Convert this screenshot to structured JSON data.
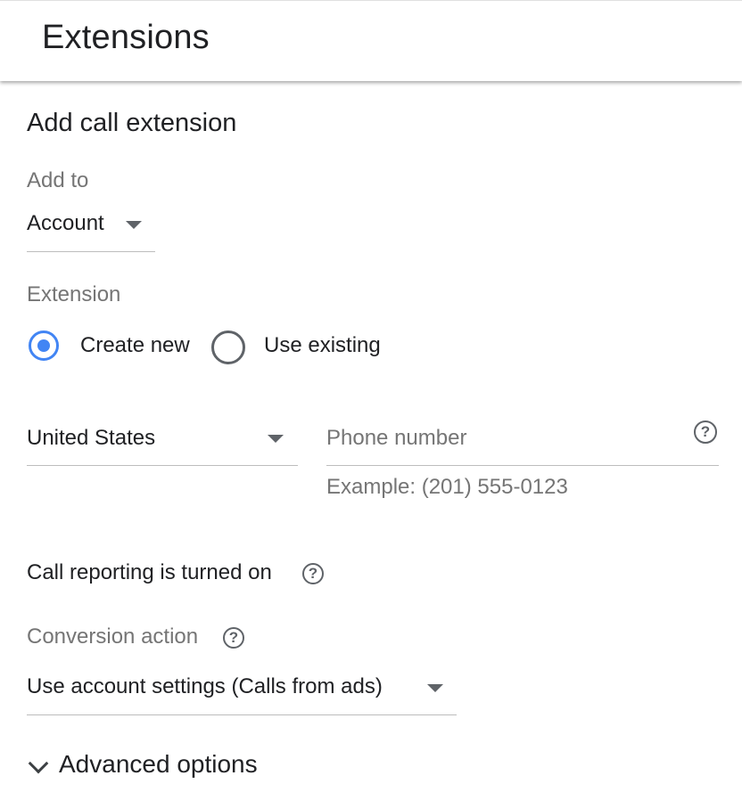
{
  "header": {
    "title": "Extensions"
  },
  "form": {
    "section_title": "Add call extension",
    "add_to": {
      "label": "Add to",
      "value": "Account"
    },
    "extension": {
      "label": "Extension",
      "options": [
        {
          "label": "Create new",
          "selected": true
        },
        {
          "label": "Use existing",
          "selected": false
        }
      ]
    },
    "country": {
      "value": "United States"
    },
    "phone": {
      "placeholder": "Phone number",
      "value": "",
      "helper": "Example: (201) 555-0123"
    },
    "call_reporting": {
      "text": "Call reporting is turned on"
    },
    "conversion_action": {
      "label": "Conversion action",
      "value": "Use account settings (Calls from ads)"
    },
    "advanced_options": {
      "label": "Advanced options"
    }
  },
  "icons": {
    "help": "?"
  },
  "colors": {
    "accent": "#4285f4",
    "muted_text": "#757575",
    "icon_gray": "#5f6368"
  }
}
